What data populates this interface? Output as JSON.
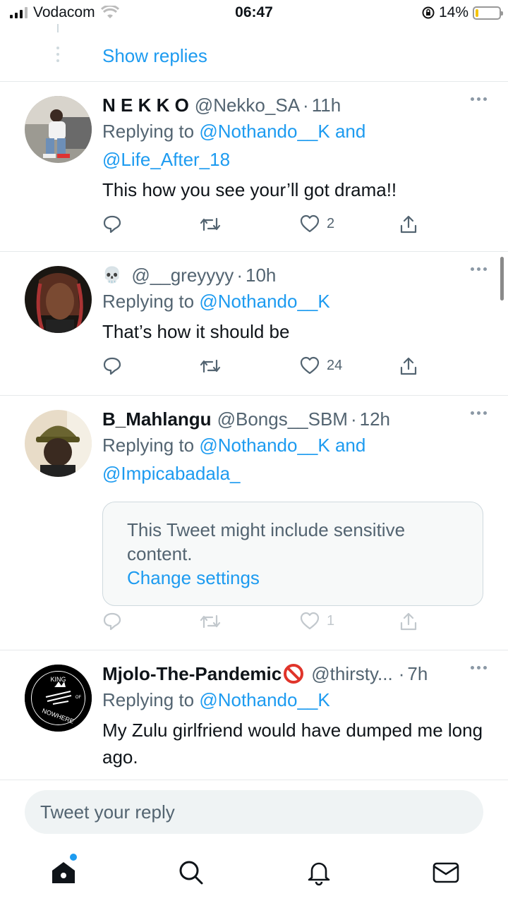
{
  "status_bar": {
    "carrier": "Vodacom",
    "time": "06:47",
    "battery": "14%",
    "battery_level": 0.14
  },
  "show_replies": "Show replies",
  "tweets": [
    {
      "name": "N E K K O",
      "handle": "@Nekko_SA",
      "dot": "·",
      "time": "11h",
      "replying_prefix": "Replying to",
      "mention1": "@Nothando__K",
      "and": "and",
      "mention2": "@Life_After_18",
      "text": "This how you see your’ll got drama!!",
      "likes": "2",
      "avatar_icon": "person-photo"
    },
    {
      "emoji": "💀",
      "handle": "@__greyyyy",
      "dot": "·",
      "time": "10h",
      "replying_prefix": "Replying to",
      "mention1": "@Nothando__K",
      "text": "That’s how it should be",
      "likes": "24",
      "avatar_icon": "person-photo"
    },
    {
      "name": "B_Mahlangu",
      "handle": "@Bongs__SBM",
      "dot": "·",
      "time": "12h",
      "replying_prefix": "Replying to",
      "mention1": "@Nothando__K",
      "and": "and",
      "mention2": "@Impicabadala_",
      "sensitive_text": "This Tweet might include sensitive content.",
      "change_settings": "Change settings",
      "likes": "1",
      "avatar_icon": "person-photo"
    },
    {
      "name": "Mjolo-The-Pandemic",
      "handle": "@thirsty...",
      "dot": "·",
      "time": "7h",
      "replying_prefix": "Replying to",
      "mention1": "@Nothando__K",
      "text": "My Zulu girlfriend would have dumped me long ago.",
      "avatar_icon": "king-of-nowhere-logo",
      "logo_text_top": "KING",
      "logo_text_mid": "OF",
      "logo_text_bottom": "NOWHERE"
    }
  ],
  "reply": {
    "placeholder": "Tweet your reply"
  },
  "tabs": [
    "home-icon",
    "search-icon",
    "notifications-icon",
    "messages-icon"
  ],
  "colors": {
    "accent": "#1d9bf0",
    "secondary_text": "#536471",
    "divider": "#e6e9eb"
  }
}
